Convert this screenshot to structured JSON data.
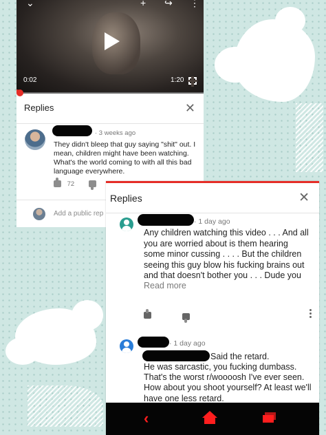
{
  "screenshot1": {
    "video": {
      "elapsed": "0:02",
      "duration": "1:20",
      "progress_fraction": 0.02
    },
    "replies_title": "Replies",
    "comment": {
      "meta": "· 3 weeks ago",
      "text": "They didn't bleep that guy saying \"shit\" out. I mean, children might have been watching. What's the world coming to with all this bad language everywhere.",
      "likes": "72"
    },
    "add_reply_placeholder": "Add a public rep"
  },
  "screenshot2": {
    "replies_title": "Replies",
    "reply1": {
      "meta": "· 1 day ago",
      "text": "Any children watching this video . . . And all you are worried about is them hearing some minor cussing . . . . But the children seeing this guy blow his fucking brains out and that doesn't bother you . . . Dude you",
      "read_more": "Read more"
    },
    "reply2": {
      "meta": "· 1 day ago",
      "text_line1": "Said the retard.",
      "text_rest": "He was sarcastic, you fucking dumbass. That's the worst r/woooosh I've ever seen. How about you shoot yourself? At least we'll have one less retard."
    }
  },
  "colors": {
    "accent_red": "#e52d27",
    "nav_red": "#ff1e1e",
    "background": "#cfe7e3"
  },
  "icons": {
    "close": "✕",
    "back": "‹",
    "add_to_queue": "+",
    "share": "↪",
    "more": "⋮"
  }
}
